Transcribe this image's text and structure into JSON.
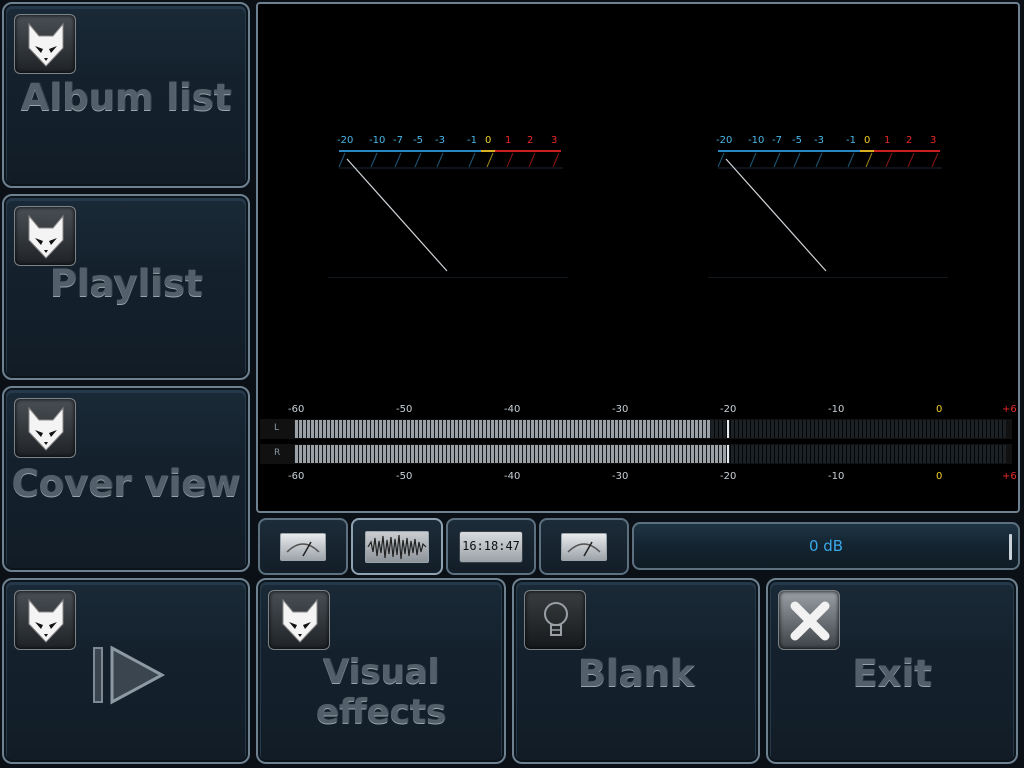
{
  "sidebar": {
    "album_list": "Album list",
    "playlist": "Playlist",
    "cover_view": "Cover view"
  },
  "bottom": {
    "visual_effects": "Visual effects",
    "blank": "Blank",
    "exit": "Exit"
  },
  "vu_meter": {
    "ticks": [
      {
        "label": "-20",
        "color": "#4ab6e8"
      },
      {
        "label": "-10",
        "color": "#4ab6e8"
      },
      {
        "label": "-7",
        "color": "#4ab6e8"
      },
      {
        "label": "-5",
        "color": "#4ab6e8"
      },
      {
        "label": "-3",
        "color": "#4ab6e8"
      },
      {
        "label": "-1",
        "color": "#4ab6e8"
      },
      {
        "label": "0",
        "color": "#f2d028"
      },
      {
        "label": "1",
        "color": "#e8282a"
      },
      {
        "label": "2",
        "color": "#e8282a"
      },
      {
        "label": "3",
        "color": "#e8282a"
      }
    ]
  },
  "peak_meter": {
    "scale": [
      {
        "label": "-60",
        "color": "#c8d0d6"
      },
      {
        "label": "-50",
        "color": "#c8d0d6"
      },
      {
        "label": "-40",
        "color": "#c8d0d6"
      },
      {
        "label": "-30",
        "color": "#c8d0d6"
      },
      {
        "label": "-20",
        "color": "#c8d0d6"
      },
      {
        "label": "-10",
        "color": "#c8d0d6"
      },
      {
        "label": "0",
        "color": "#f2d028"
      },
      {
        "label": "+6",
        "color": "#e8282a"
      }
    ],
    "channels": [
      {
        "name": "L",
        "level_fraction": 0.585,
        "peak_fraction": 0.608
      },
      {
        "name": "R",
        "level_fraction": 0.608,
        "peak_fraction": 0.608
      }
    ]
  },
  "tools": {
    "clock": "16:18:47"
  },
  "volume": {
    "value": "0 dB",
    "accent": "#3aa8e8"
  }
}
